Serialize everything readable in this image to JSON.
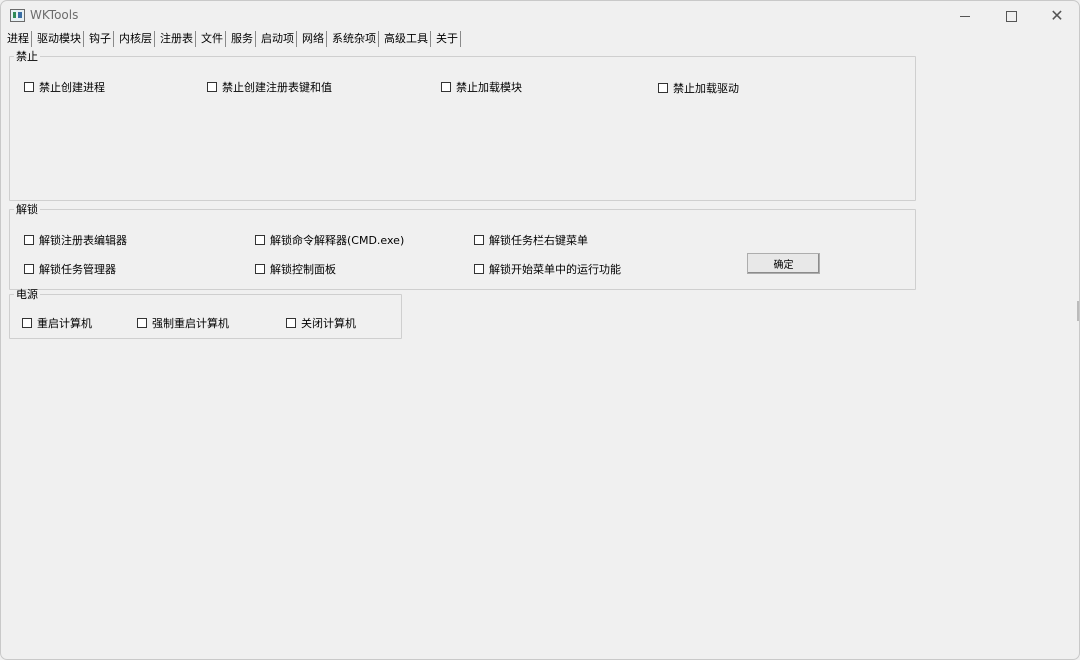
{
  "window": {
    "title": "WKTools",
    "controls": {
      "minimize": "minimize-icon",
      "maximize": "maximize-icon",
      "close": "close-icon"
    }
  },
  "menu": [
    "进程",
    "驱动模块",
    "钩子",
    "内核层",
    "注册表",
    "文件",
    "服务",
    "启动项",
    "网络",
    "系统杂项",
    "高级工具",
    "关于"
  ],
  "groups": {
    "prohibit": {
      "title": "禁止",
      "items": [
        "禁止创建进程",
        "禁止创建注册表键和值",
        "禁止加载模块",
        "禁止加载驱动"
      ]
    },
    "unlock": {
      "title": "解锁",
      "items": [
        "解锁注册表编辑器",
        "解锁命令解释器(CMD.exe)",
        "解锁任务栏右键菜单",
        "解锁任务管理器",
        "解锁控制面板",
        "解锁开始菜单中的运行功能"
      ],
      "confirm_label": "确定"
    },
    "power": {
      "title": "电源",
      "items": [
        "重启计算机",
        "强制重启计算机",
        "关闭计算机"
      ]
    }
  }
}
